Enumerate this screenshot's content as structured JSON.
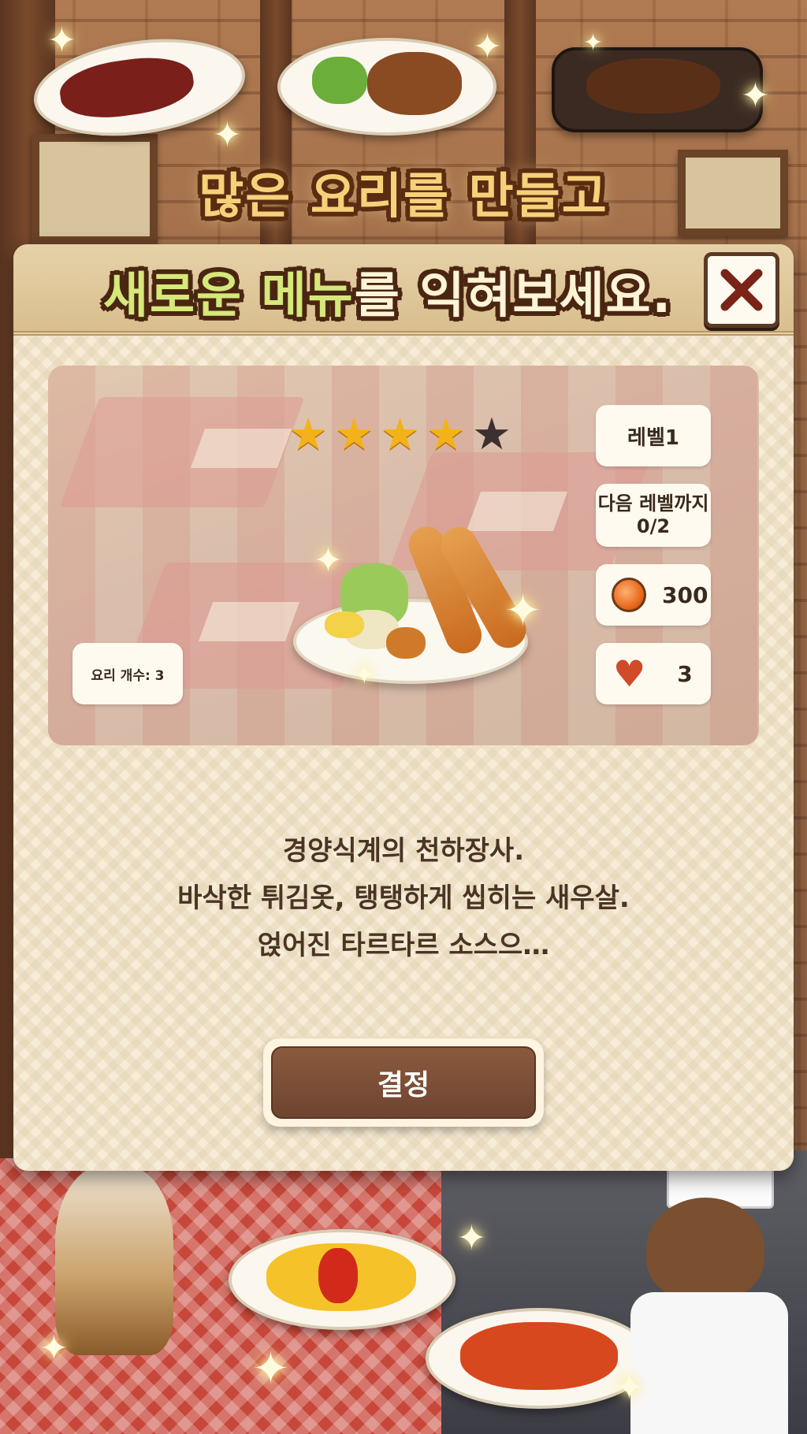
{
  "promo": {
    "line1": "많은 요리를 만들고",
    "line2_highlight": "새로운 메뉴",
    "line2_rest": "를 익혀보세요."
  },
  "dialog": {
    "close_icon": "close-icon",
    "rating": {
      "value": 4,
      "max": 5
    },
    "level_label": "레벨1",
    "next_level_label": "다음 레벨까지",
    "next_level_progress": "0/2",
    "coin_icon": "coin-icon",
    "coin_value": "300",
    "heart_icon": "heart-icon",
    "heart_value": "3",
    "dish_count": "요리 개수: 3",
    "description_lines": [
      "경양식계의 천하장사.",
      "바삭한 튀김옷, 탱탱하게 씹히는 새우살.",
      "얹어진 타르타르 소스으…"
    ],
    "confirm_label": "결정"
  },
  "colors": {
    "accent_brown": "#6e4430",
    "star_on": "#f3b21a",
    "star_off": "#3c3030",
    "heart": "#d14a2a",
    "coin": "#e86a1e",
    "headline_gold": "#f7d17a",
    "headline_green": "#d5e87a"
  }
}
